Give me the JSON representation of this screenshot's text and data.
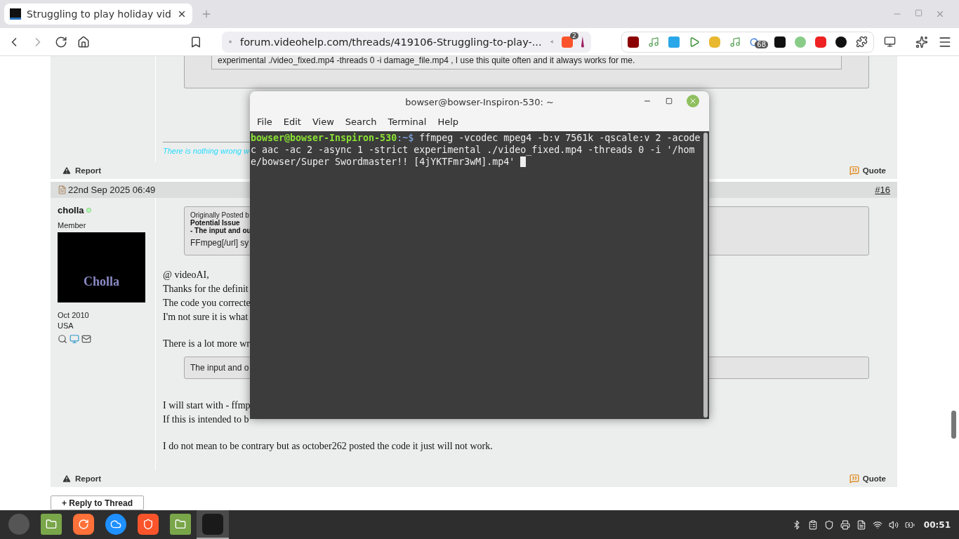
{
  "browser": {
    "tabs": [
      {
        "title": "Struggling to play holiday vid",
        "selected": true
      }
    ],
    "url": "forum.videohelp.com/threads/419106-Struggling-to-play-...",
    "shield_badge": "2",
    "weather_badge": "68"
  },
  "page": {
    "prev_post": {
      "code_text": "experimental ./video_fixed.mp4 -threads 0 -i damage_file.mp4 , I use this quite often and it always works for me.",
      "signature": "There is nothing wrong w",
      "report": "Report",
      "quote": "Quote"
    },
    "post": {
      "date": "22nd Sep 2025 06:49",
      "number": "#16",
      "user": "cholla",
      "online": true,
      "rank": "Member",
      "avatar_text": "Cholla",
      "joined": "Oct 2010",
      "location": "USA",
      "quote": {
        "header": "Originally Posted b",
        "lines": [
          "Potential Issue",
          "- The input and ou"
        ],
        "body": "FFmpeg[/url] sy"
      },
      "blocks": [
        {
          "kind": "lines",
          "lines": [
            "@ videoAI,",
            "Thanks for the definit",
            "The code you correcte",
            "I'm not sure it is what"
          ]
        },
        {
          "kind": "lines",
          "lines": [
            "There is a lot more wr"
          ]
        },
        {
          "kind": "quote",
          "text": "The input and o"
        },
        {
          "kind": "lines",
          "lines": [
            "I will start with - ffmp",
            "If this is intended to b"
          ]
        },
        {
          "kind": "lines",
          "lines": [
            "I do not mean to be contrary but as october262 posted the code it just will not work."
          ]
        }
      ],
      "report": "Report",
      "quote_button": "Quote"
    },
    "reply_button": "+ Reply to Thread"
  },
  "terminal": {
    "title": "bowser@bowser-Inspiron-530: ~",
    "menu": [
      "File",
      "Edit",
      "View",
      "Search",
      "Terminal",
      "Help"
    ],
    "prompt": "bowser@bowser-Inspiron-530",
    "prompt_suffix": ":~$",
    "command": " ffmpeg -vcodec mpeg4 -b:v 7561k -qscale:v 2 -acodec aac -ac 2 -async 1 -strict experimental ./video_fixed.mp4 -threads 0 -i '/home/bowser/Super Swordmaster!! [4jYKTFmr3wM].mp4' "
  },
  "taskbar": {
    "apps": [
      {
        "kind": "folder",
        "selected": false
      },
      {
        "kind": "firefox",
        "selected": false
      },
      {
        "kind": "browser",
        "selected": false
      },
      {
        "kind": "lion",
        "selected": false
      },
      {
        "kind": "folder",
        "selected": false
      },
      {
        "kind": "terminal",
        "selected": true
      }
    ],
    "clock": "00:51"
  }
}
